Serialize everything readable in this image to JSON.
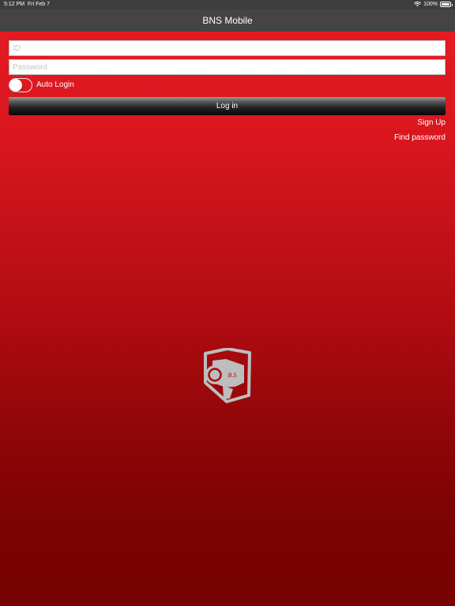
{
  "status_bar": {
    "time": "5:12 PM",
    "date": "Fri Feb 7",
    "battery_text": "100%",
    "battery_level": 1.0,
    "wifi_icon": "wifi-icon",
    "battery_icon": "battery-icon"
  },
  "nav": {
    "title": "BNS Mobile"
  },
  "login_form": {
    "id_placeholder": "ID",
    "id_value": "",
    "password_placeholder": "Password",
    "password_value": "",
    "auto_login_label": "Auto Login",
    "auto_login_on": false,
    "login_button_label": "Log in"
  },
  "links": {
    "sign_up": "Sign Up",
    "find_password": "Find password"
  },
  "logo": {
    "icon": "security-camera-shield-logo",
    "monogram": "B.S"
  },
  "colors": {
    "bar_bg": "#444444",
    "gradient_top": "#e81c24",
    "gradient_bottom": "#760202",
    "logo_gray": "#bdbdbd"
  }
}
